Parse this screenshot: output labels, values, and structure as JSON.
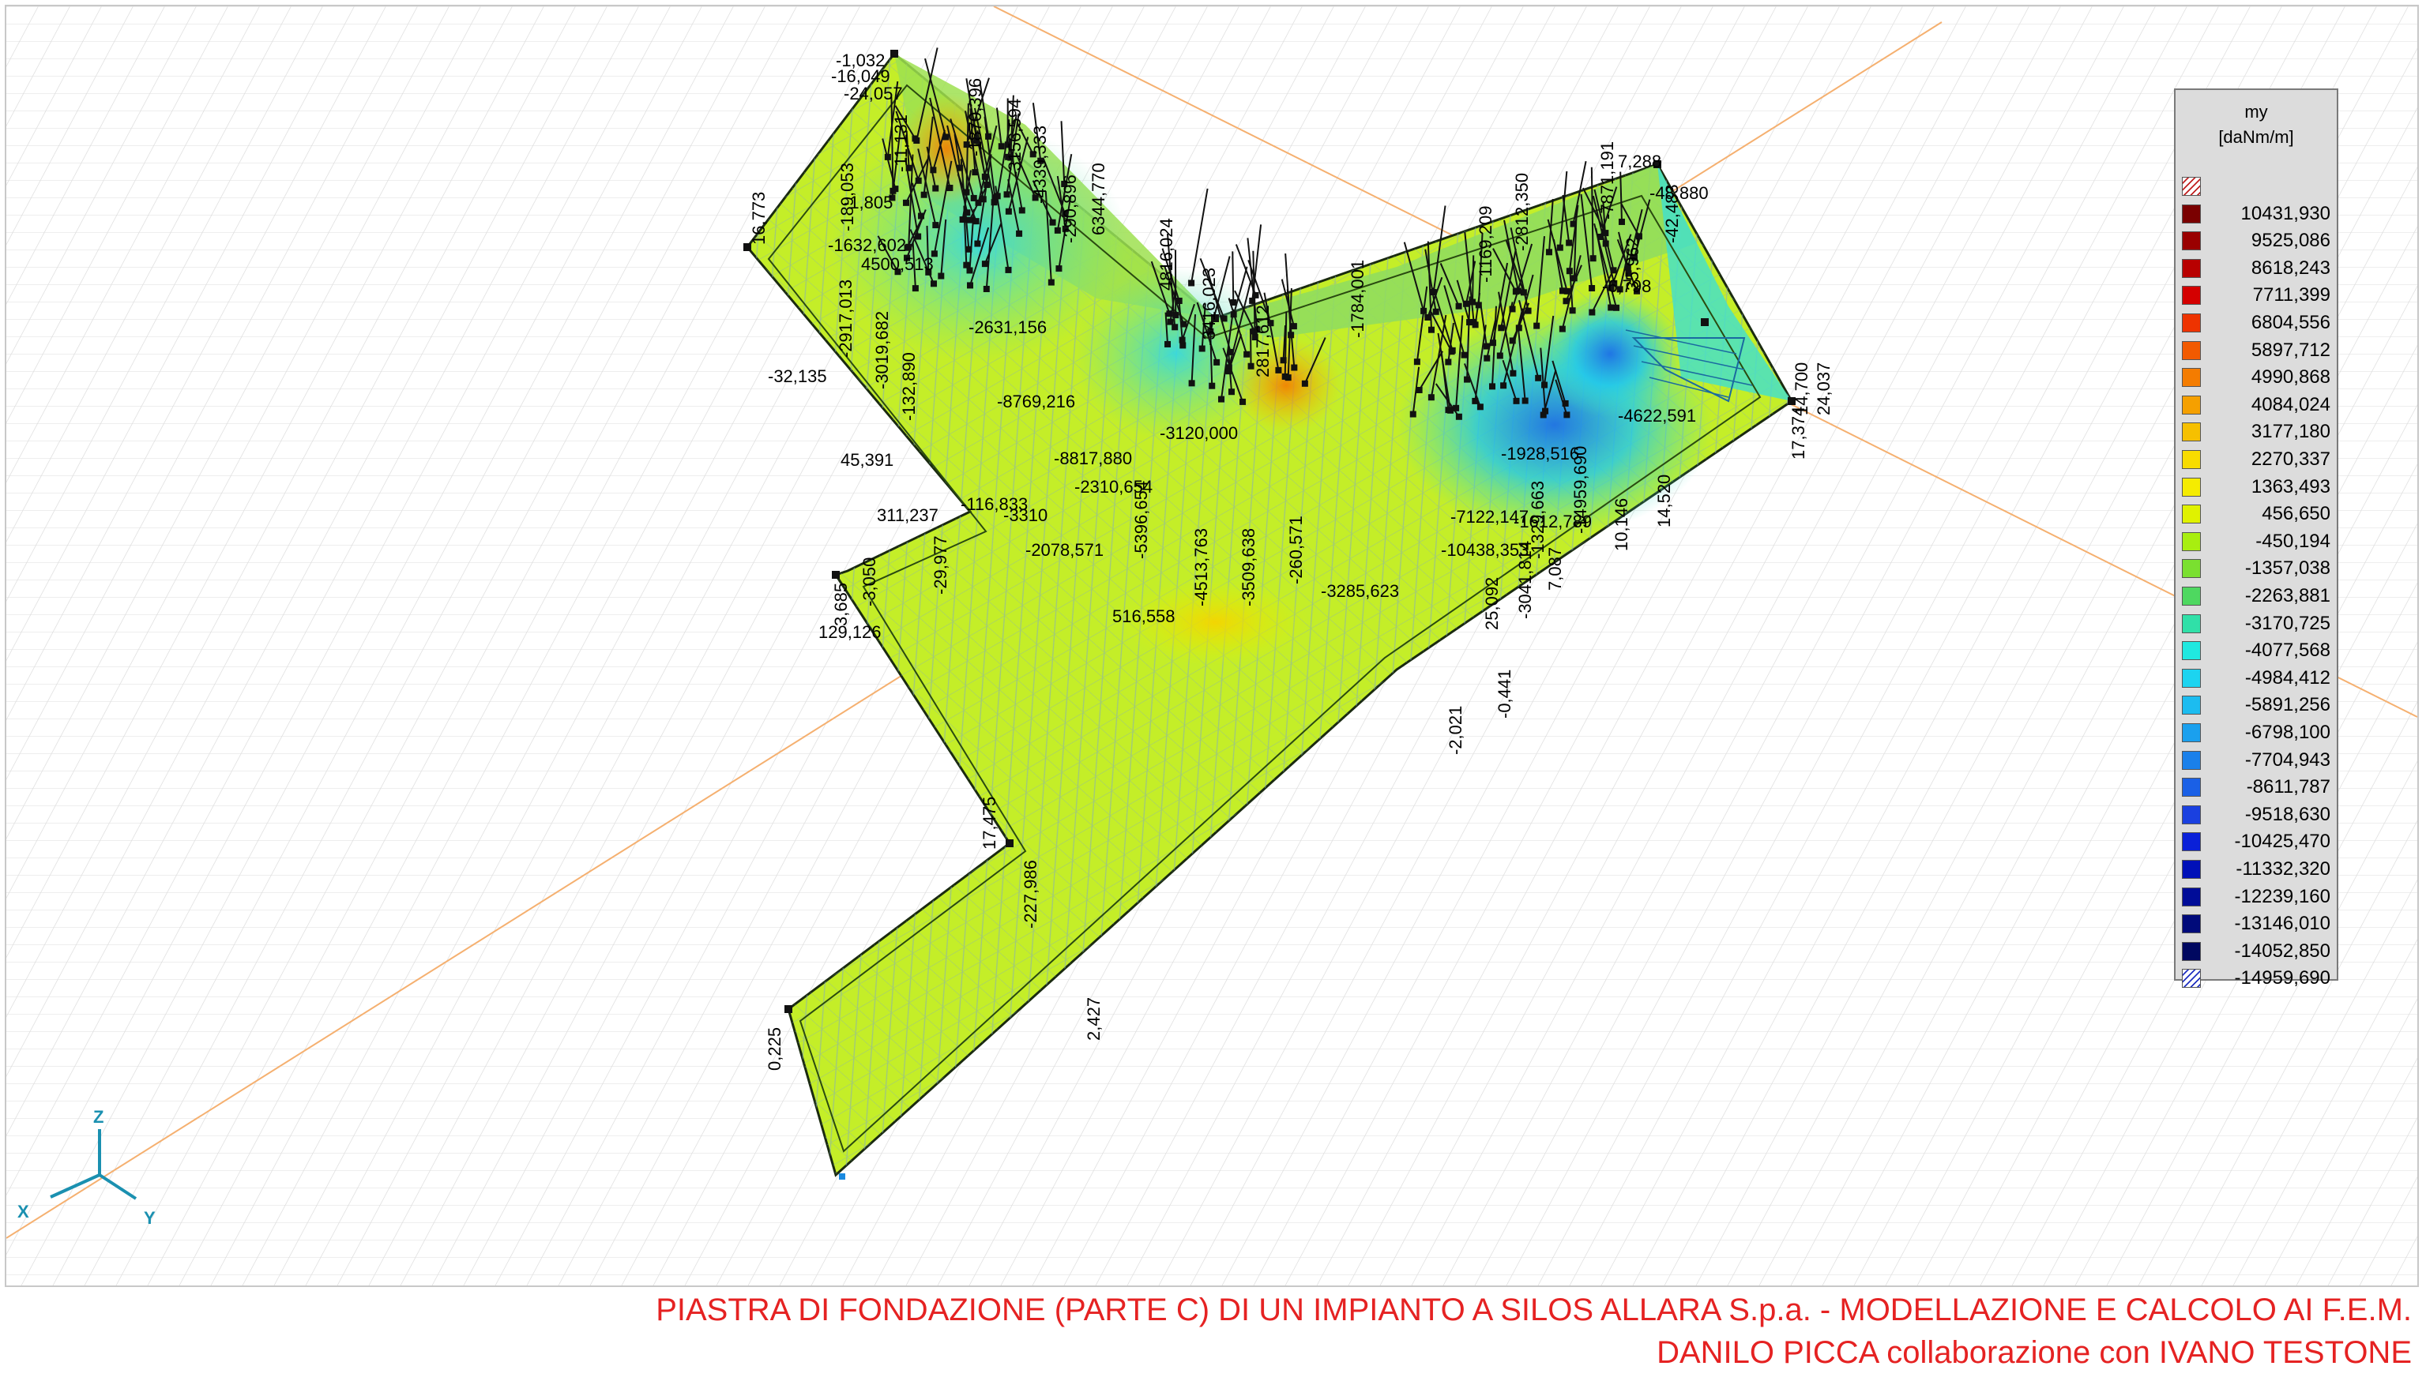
{
  "legend": {
    "title": "my",
    "unit": "[daNm/m]",
    "entries": [
      {
        "value": "",
        "color": "#ffffff",
        "hatched": true
      },
      {
        "value": "10431,930",
        "color": "#7a0000"
      },
      {
        "value": "9525,086",
        "color": "#9a0000"
      },
      {
        "value": "8618,243",
        "color": "#b80000"
      },
      {
        "value": "7711,399",
        "color": "#d40000"
      },
      {
        "value": "6804,556",
        "color": "#ee3300"
      },
      {
        "value": "5897,712",
        "color": "#f25a00"
      },
      {
        "value": "4990,868",
        "color": "#f47c00"
      },
      {
        "value": "4084,024",
        "color": "#f5a000"
      },
      {
        "value": "3177,180",
        "color": "#f6c000"
      },
      {
        "value": "2270,337",
        "color": "#f8dc00"
      },
      {
        "value": "1363,493",
        "color": "#f5ec00"
      },
      {
        "value": "456,650",
        "color": "#e0f200"
      },
      {
        "value": "-450,194",
        "color": "#a8ee10"
      },
      {
        "value": "-1357,038",
        "color": "#7ae030"
      },
      {
        "value": "-2263,881",
        "color": "#4ed860"
      },
      {
        "value": "-3170,725",
        "color": "#30e0a8"
      },
      {
        "value": "-4077,568",
        "color": "#20e8e0"
      },
      {
        "value": "-4984,412",
        "color": "#1cd4f0"
      },
      {
        "value": "-5891,256",
        "color": "#1cbcf0"
      },
      {
        "value": "-6798,100",
        "color": "#1aa0ee"
      },
      {
        "value": "-7704,943",
        "color": "#1a80ea"
      },
      {
        "value": "-8611,787",
        "color": "#1a60e6"
      },
      {
        "value": "-9518,630",
        "color": "#1a40e0"
      },
      {
        "value": "-10425,470",
        "color": "#0a20d8"
      },
      {
        "value": "-11332,320",
        "color": "#0010b8"
      },
      {
        "value": "-12239,160",
        "color": "#000c98"
      },
      {
        "value": "-13146,010",
        "color": "#000a7a"
      },
      {
        "value": "-14052,850",
        "color": "#000860"
      },
      {
        "value": "-14959,690",
        "color": "#ffffff",
        "hatched": true
      }
    ]
  },
  "labels": [
    "-1,032",
    "-16,049",
    "-24,057",
    "16,773",
    "-189,053",
    "-2917,013",
    "-3019,682",
    "-32,135",
    "-132,890",
    "45,391",
    "311,237",
    "-116,833",
    "-29,977",
    "-3,050",
    "3,685",
    "129,126",
    "516,558",
    "-2078,571",
    "-2310,654",
    "-5396,654",
    "-4513,763",
    "-3509,638",
    "-260,571",
    "-3285,623",
    "-10438,353",
    "25,092",
    "-3041,814",
    "7,087",
    "-14959,690",
    "-4622,591",
    "10,146",
    "14,520",
    "17,374",
    "14,700",
    "24,037",
    "7,288",
    "-48,880",
    "-42,483",
    "-0,441",
    "-2,021",
    "17,475",
    "-227,986",
    "0,225",
    "2,427",
    "6344,770",
    "4816,024",
    "-3416,023",
    "2817,612",
    "-8769,216",
    "-1632,602",
    "4500,513",
    "-290,896",
    "-1870,396",
    "-3156,594",
    "-4339,333",
    "-7871,191",
    "-2812,350",
    "-1169,209",
    "-1784,001",
    "-7122,147",
    "-1928,516",
    "-1612,789",
    "-1329,663",
    "-2631,156",
    "-3120,000",
    "-8817,880",
    "-3310",
    "-11,131",
    "35,962",
    "-6,798",
    "-1,805"
  ],
  "axes": {
    "x": "X",
    "y": "Y",
    "z": "Z"
  },
  "footer": {
    "line1": "PIASTRA DI FONDAZIONE (PARTE C) DI UN IMPIANTO A SILOS ALLARA S.p.a. - MODELLAZIONE E CALCOLO AI F.E.M.",
    "line2": "DANILO PICCA collaborazione con IVANO TESTONE"
  }
}
